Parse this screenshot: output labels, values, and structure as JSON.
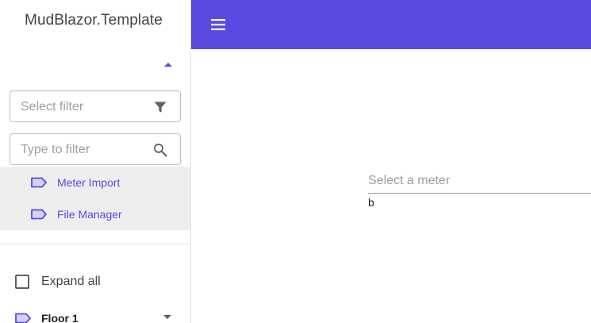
{
  "app": {
    "title": "MudBlazor.Template"
  },
  "colors": {
    "primary": "#594ae2",
    "nav_bg": "#eeeeee",
    "placeholder": "#9e9e9e"
  },
  "sidebar": {
    "collapse_icon": "caret-up-icon",
    "filter_select": {
      "placeholder": "Select filter",
      "icon": "filter-icon"
    },
    "filter_input": {
      "placeholder": "Type to filter",
      "icon": "search-icon"
    },
    "nav_items": [
      {
        "label": "Meter Import",
        "icon": "label-icon"
      },
      {
        "label": "File Manager",
        "icon": "label-icon"
      }
    ],
    "expand_all": {
      "label": "Expand all",
      "checked": false
    },
    "tree": [
      {
        "label": "Floor 1",
        "icon": "label-icon",
        "expand_icon": "caret-down-icon"
      }
    ]
  },
  "appbar": {
    "menu_icon": "hamburger-menu-icon"
  },
  "main": {
    "meter_select": {
      "placeholder": "Select a meter"
    },
    "value_text": "b"
  }
}
